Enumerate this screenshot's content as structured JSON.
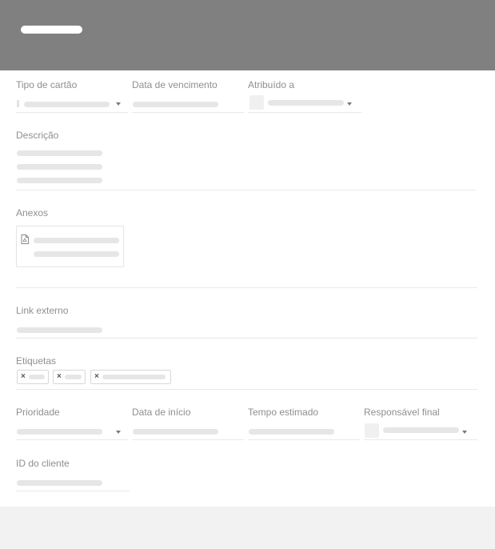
{
  "colors": {
    "header": "#808080",
    "card": "#ffffff",
    "page": "#f2f2f2",
    "placeholder": "#e6e6e6"
  },
  "fields": {
    "tipo": "Tipo de cartão",
    "vencimento": "Data de vencimento",
    "atribuido": "Atribuído a",
    "descricao": "Descrição",
    "anexos": "Anexos",
    "link": "Link externo",
    "etiquetas": "Etiquetas",
    "prioridade": "Prioridade",
    "inicio": "Data de início",
    "tempo": "Tempo estimado",
    "responsavel": "Responsável final",
    "cliente": "ID do cliente"
  },
  "chips": {
    "remove_glyph": "×"
  },
  "icons": {
    "attachment": "pdf-file-icon",
    "dropdown": "caret-down-icon",
    "remove": "close-icon"
  }
}
